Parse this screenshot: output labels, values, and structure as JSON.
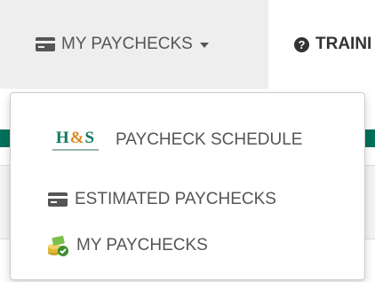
{
  "nav": {
    "my_paychecks": {
      "label": "MY PAYCHECKS",
      "icon": "credit-card-icon"
    },
    "training": {
      "label": "TRAINI",
      "icon": "question-circle-icon",
      "icon_glyph": "?"
    }
  },
  "dropdown": {
    "items": [
      {
        "label": "PAYCHECK SCHEDULE",
        "icon": "hs-company-logo",
        "logo_text_left": "H",
        "logo_text_amp": "&",
        "logo_text_right": "S"
      },
      {
        "label": "ESTIMATED PAYCHECKS",
        "icon": "credit-card-icon"
      },
      {
        "label": "MY PAYCHECKS",
        "icon": "money-stack-icon"
      }
    ]
  },
  "colors": {
    "active_tab_bg": "#eeeeee",
    "text": "#555555",
    "brand_green": "#0d7a5f",
    "teal_band": "#00705a"
  }
}
